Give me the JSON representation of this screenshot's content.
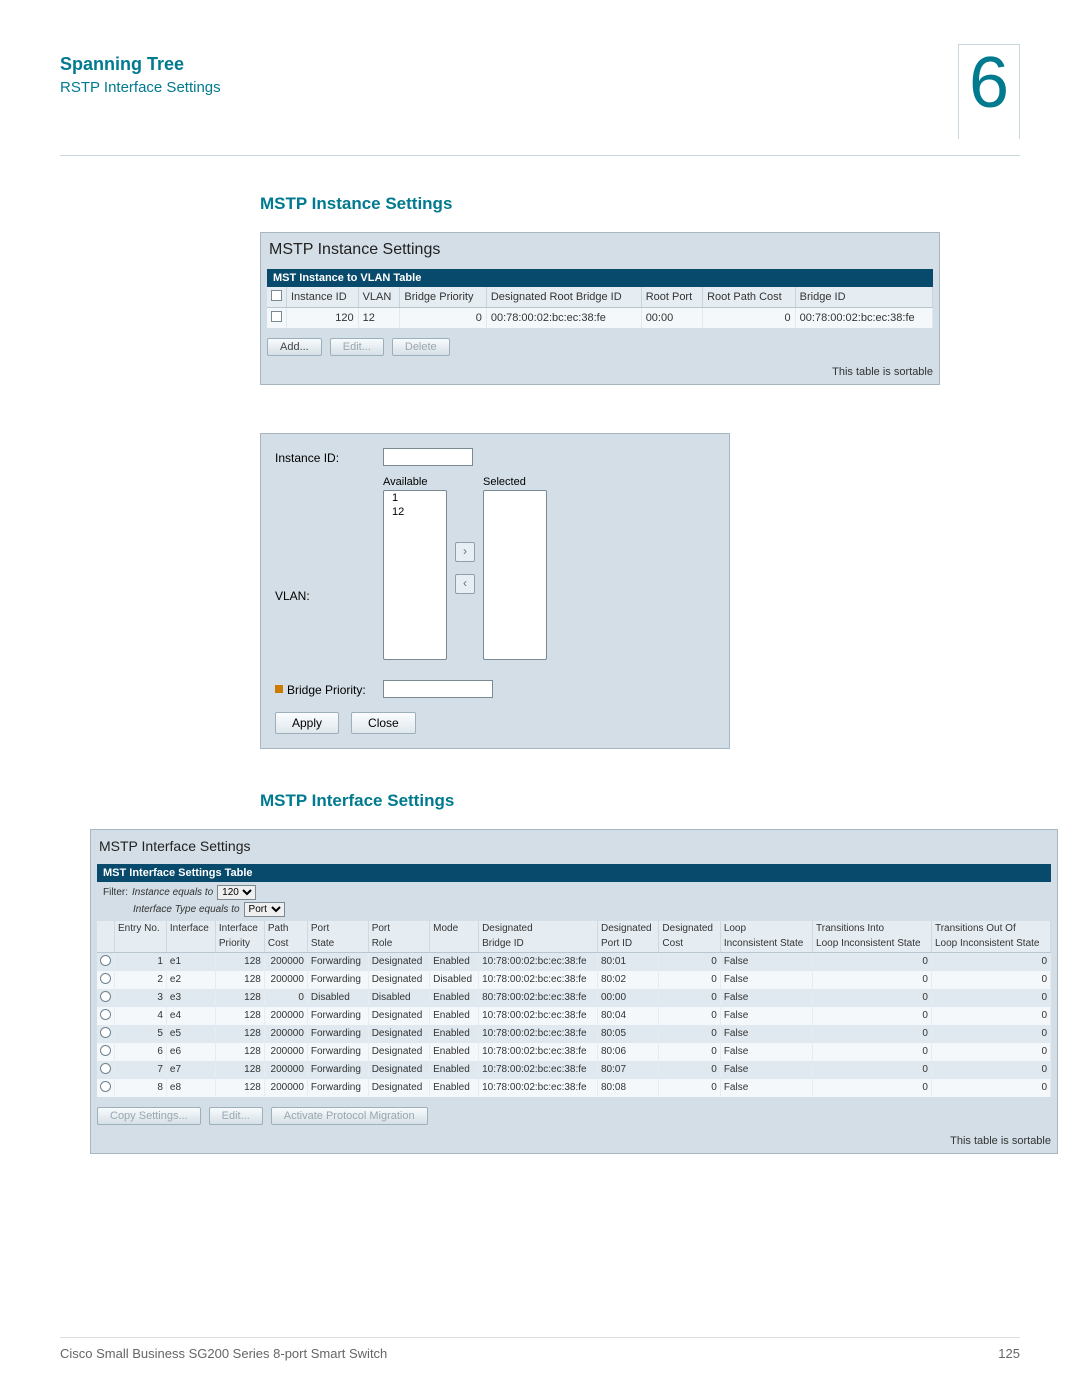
{
  "header": {
    "title": "Spanning Tree",
    "subtitle": "RSTP Interface Settings",
    "chapter_number": "6"
  },
  "section1": {
    "heading": "MSTP Instance Settings",
    "panel_title": "MSTP Instance Settings",
    "table_caption": "MST Instance to VLAN Table",
    "columns": [
      "Instance ID",
      "VLAN",
      "Bridge Priority",
      "Designated Root Bridge ID",
      "Root Port",
      "Root Path Cost",
      "Bridge ID"
    ],
    "rows": [
      {
        "instance_id": "120",
        "vlan": "12",
        "bridge_priority": "0",
        "root_bridge_id": "00:78:00:02:bc:ec:38:fe",
        "root_port": "00:00",
        "root_path_cost": "0",
        "bridge_id": "00:78:00:02:bc:ec:38:fe"
      }
    ],
    "buttons": {
      "add": "Add...",
      "edit": "Edit...",
      "delete": "Delete"
    },
    "sortable_note": "This table is sortable"
  },
  "dialog": {
    "instance_id_label": "Instance ID:",
    "available_label": "Available",
    "selected_label": "Selected",
    "available_items": [
      "1",
      "12"
    ],
    "vlan_label": "VLAN:",
    "bridge_priority_label": "Bridge Priority:",
    "apply": "Apply",
    "close": "Close"
  },
  "section2": {
    "heading": "MSTP Interface Settings",
    "panel_title": "MSTP Interface Settings",
    "table_caption": "MST Interface Settings Table",
    "filter_prefix": "Filter:",
    "filter_instance_label": "Instance equals to",
    "filter_instance_value": "120",
    "filter_iftype_label": "Interface Type equals to",
    "filter_iftype_value": "Port",
    "columns_line1": [
      "",
      "Entry No.",
      "Interface",
      "Interface",
      "Path",
      "Port",
      "Port",
      "Mode",
      "Designated",
      "Designated",
      "Designated",
      "Loop",
      "Transitions Into",
      "Transitions Out Of"
    ],
    "columns_line2": [
      "",
      "",
      "",
      "Priority",
      "Cost",
      "State",
      "Role",
      "",
      "Bridge ID",
      "Port ID",
      "Cost",
      "Inconsistent State",
      "Loop Inconsistent State",
      "Loop Inconsistent State"
    ],
    "rows": [
      {
        "no": "1",
        "if": "e1",
        "prio": "128",
        "cost": "200000",
        "state": "Forwarding",
        "role": "Designated",
        "mode": "Enabled",
        "dbid": "10:78:00:02:bc:ec:38:fe",
        "dpid": "80:01",
        "dcost": "0",
        "loop": "False",
        "tin": "0",
        "tout": "0"
      },
      {
        "no": "2",
        "if": "e2",
        "prio": "128",
        "cost": "200000",
        "state": "Forwarding",
        "role": "Designated",
        "mode": "Disabled",
        "dbid": "10:78:00:02:bc:ec:38:fe",
        "dpid": "80:02",
        "dcost": "0",
        "loop": "False",
        "tin": "0",
        "tout": "0"
      },
      {
        "no": "3",
        "if": "e3",
        "prio": "128",
        "cost": "0",
        "state": "Disabled",
        "role": "Disabled",
        "mode": "Enabled",
        "dbid": "80:78:00:02:bc:ec:38:fe",
        "dpid": "00:00",
        "dcost": "0",
        "loop": "False",
        "tin": "0",
        "tout": "0"
      },
      {
        "no": "4",
        "if": "e4",
        "prio": "128",
        "cost": "200000",
        "state": "Forwarding",
        "role": "Designated",
        "mode": "Enabled",
        "dbid": "10:78:00:02:bc:ec:38:fe",
        "dpid": "80:04",
        "dcost": "0",
        "loop": "False",
        "tin": "0",
        "tout": "0"
      },
      {
        "no": "5",
        "if": "e5",
        "prio": "128",
        "cost": "200000",
        "state": "Forwarding",
        "role": "Designated",
        "mode": "Enabled",
        "dbid": "10:78:00:02:bc:ec:38:fe",
        "dpid": "80:05",
        "dcost": "0",
        "loop": "False",
        "tin": "0",
        "tout": "0"
      },
      {
        "no": "6",
        "if": "e6",
        "prio": "128",
        "cost": "200000",
        "state": "Forwarding",
        "role": "Designated",
        "mode": "Enabled",
        "dbid": "10:78:00:02:bc:ec:38:fe",
        "dpid": "80:06",
        "dcost": "0",
        "loop": "False",
        "tin": "0",
        "tout": "0"
      },
      {
        "no": "7",
        "if": "e7",
        "prio": "128",
        "cost": "200000",
        "state": "Forwarding",
        "role": "Designated",
        "mode": "Enabled",
        "dbid": "10:78:00:02:bc:ec:38:fe",
        "dpid": "80:07",
        "dcost": "0",
        "loop": "False",
        "tin": "0",
        "tout": "0"
      },
      {
        "no": "8",
        "if": "e8",
        "prio": "128",
        "cost": "200000",
        "state": "Forwarding",
        "role": "Designated",
        "mode": "Enabled",
        "dbid": "10:78:00:02:bc:ec:38:fe",
        "dpid": "80:08",
        "dcost": "0",
        "loop": "False",
        "tin": "0",
        "tout": "0"
      }
    ],
    "buttons": {
      "copy": "Copy Settings...",
      "edit": "Edit...",
      "activate": "Activate Protocol Migration"
    },
    "sortable_note": "This table is sortable"
  },
  "footer": {
    "left": "Cisco Small Business SG200 Series 8-port Smart Switch",
    "right": "125"
  }
}
